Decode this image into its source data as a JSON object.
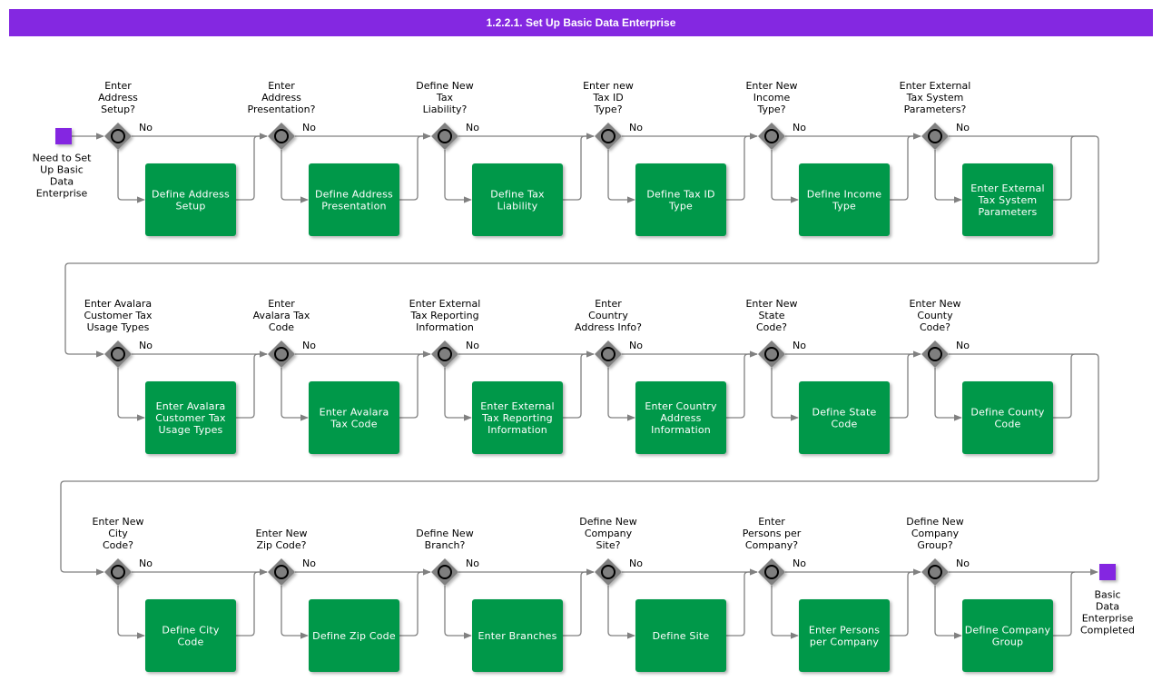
{
  "header": {
    "title": "1.2.2.1. Set Up Basic Data Enterprise"
  },
  "colors": {
    "header_bg": "#8428e1",
    "event": "#8428e1",
    "task": "#00984a",
    "gateway": "#808080",
    "flow": "#808080"
  },
  "start_event": {
    "label": [
      "Need to Set",
      "Up Basic",
      "Data",
      "Enterprise"
    ]
  },
  "end_event": {
    "label": [
      "Basic",
      "Data",
      "Enterprise",
      "Completed"
    ]
  },
  "no_label": "No",
  "rows": [
    [
      {
        "question": [
          "Enter",
          "Address",
          "Setup?"
        ],
        "task": [
          "Define Address",
          "Setup"
        ]
      },
      {
        "question": [
          "Enter",
          "Address",
          "Presentation?"
        ],
        "task": [
          "Define Address",
          "Presentation"
        ]
      },
      {
        "question": [
          "Define New",
          "Tax",
          "Liability?"
        ],
        "task": [
          "Define Tax",
          "Liability"
        ]
      },
      {
        "question": [
          "Enter new",
          "Tax ID",
          "Type?"
        ],
        "task": [
          "Define Tax ID",
          "Type"
        ]
      },
      {
        "question": [
          "Enter New",
          "Income",
          "Type?"
        ],
        "task": [
          "Define Income",
          "Type"
        ]
      },
      {
        "question": [
          "Enter External",
          "Tax System",
          "Parameters?"
        ],
        "task": [
          "Enter External",
          "Tax System",
          "Parameters"
        ]
      }
    ],
    [
      {
        "question": [
          "Enter Avalara",
          "Customer Tax",
          "Usage Types"
        ],
        "task": [
          "Enter Avalara",
          "Customer Tax",
          "Usage Types"
        ]
      },
      {
        "question": [
          "Enter",
          "Avalara Tax",
          "Code"
        ],
        "task": [
          "Enter Avalara",
          "Tax Code"
        ]
      },
      {
        "question": [
          "Enter External",
          "Tax Reporting",
          "Information"
        ],
        "task": [
          "Enter External",
          "Tax Reporting",
          "Information"
        ]
      },
      {
        "question": [
          "Enter",
          "Country",
          "Address Info?"
        ],
        "task": [
          "Enter Country",
          "Address",
          "Information"
        ]
      },
      {
        "question": [
          "Enter New",
          "State",
          "Code?"
        ],
        "task": [
          "Define State",
          "Code"
        ]
      },
      {
        "question": [
          "Enter New",
          "County",
          "Code?"
        ],
        "task": [
          "Define County",
          "Code"
        ]
      }
    ],
    [
      {
        "question": [
          "Enter New",
          "City",
          "Code?"
        ],
        "task": [
          "Define City",
          "Code"
        ]
      },
      {
        "question": [
          "Enter New",
          "Zip Code?"
        ],
        "task": [
          "Define Zip Code"
        ]
      },
      {
        "question": [
          "Define New",
          "Branch?"
        ],
        "task": [
          "Enter Branches"
        ]
      },
      {
        "question": [
          "Define New",
          "Company",
          "Site?"
        ],
        "task": [
          "Define Site"
        ]
      },
      {
        "question": [
          "Enter",
          "Persons per",
          "Company?"
        ],
        "task": [
          "Enter Persons",
          "per Company"
        ]
      },
      {
        "question": [
          "Define New",
          "Company",
          "Group?"
        ],
        "task": [
          "Define Company",
          "Group"
        ]
      }
    ]
  ]
}
